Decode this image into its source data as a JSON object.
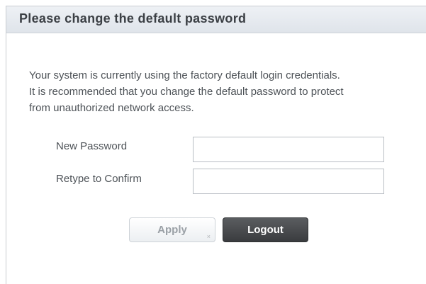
{
  "dialog": {
    "title": "Please change the default password",
    "message_lines": [
      "Your system is currently using the factory default login credentials.",
      "It is recommended that you change the default password to protect",
      "from unauthorized network access."
    ]
  },
  "form": {
    "new_password_label": "New Password",
    "new_password_value": "",
    "confirm_label": "Retype to Confirm",
    "confirm_value": ""
  },
  "buttons": {
    "apply_label": "Apply",
    "apply_close_glyph": "×",
    "logout_label": "Logout"
  },
  "colors": {
    "title_bar": "#e6eaef",
    "logout_button": "#454749",
    "apply_button_text": "#9aa0a6"
  }
}
